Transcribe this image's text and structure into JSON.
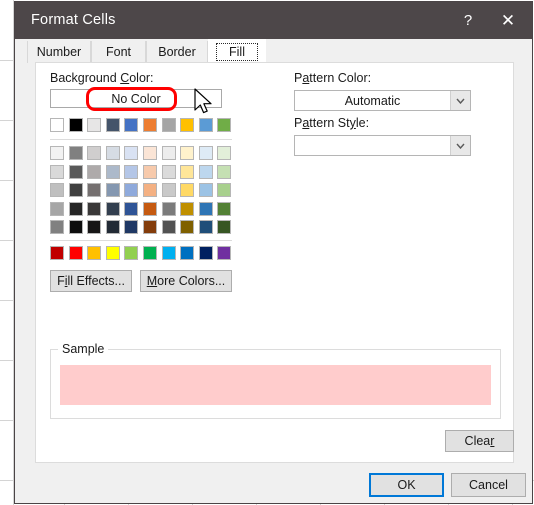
{
  "window": {
    "title": "Format Cells",
    "help_icon": "?",
    "close_icon": "✕"
  },
  "tabs": [
    {
      "label": "Number",
      "active": false
    },
    {
      "label": "Font",
      "active": false
    },
    {
      "label": "Border",
      "active": false
    },
    {
      "label": "Fill",
      "active": true
    }
  ],
  "fill_tab": {
    "background_color_label_pre": "Background ",
    "background_color_label_accel": "C",
    "background_color_label_post": "olor:",
    "no_color_button": "No Color",
    "fill_effects_pre": "F",
    "fill_effects_accel": "i",
    "fill_effects_post": "ll Effects...",
    "more_colors_accel": "M",
    "more_colors_post": "ore Colors...",
    "pattern_color_label_pre": "P",
    "pattern_color_label_accel": "a",
    "pattern_color_label_post": "ttern Color:",
    "pattern_color_value": "Automatic",
    "pattern_style_label_pre": "P",
    "pattern_style_label_accel": "a",
    "pattern_style_label_post": "ttern St",
    "pattern_style_label_accel2": "y",
    "pattern_style_label_post2": "le:",
    "pattern_style_value": "",
    "dropdown_arrow_icon": "⌄",
    "sample_group_label": "Sample",
    "sample_fill_color": "#ffcccc"
  },
  "palette": {
    "theme_row": [
      "#ffffff",
      "#000000",
      "#e7e6e6",
      "#44546a",
      "#4472c4",
      "#ed7d31",
      "#a5a5a5",
      "#ffc000",
      "#5b9bd5",
      "#70ad47"
    ],
    "theme_variants": [
      [
        "#f2f2f2",
        "#808080",
        "#d0cece",
        "#d6dce4",
        "#d9e2f3",
        "#fbe5d6",
        "#ededed",
        "#fff2cc",
        "#deebf6",
        "#e2efd9"
      ],
      [
        "#d9d9d9",
        "#595959",
        "#aeaaaa",
        "#acb9ca",
        "#b4c6e7",
        "#f7caac",
        "#dbdbdb",
        "#ffe699",
        "#bdd7ee",
        "#c5e0b3"
      ],
      [
        "#bfbfbf",
        "#404040",
        "#757070",
        "#8497b0",
        "#8faadc",
        "#f4b183",
        "#c9c9c9",
        "#ffd965",
        "#9cc3e5",
        "#a8d08d"
      ],
      [
        "#a6a6a6",
        "#262626",
        "#3a3838",
        "#333f4f",
        "#2f5496",
        "#c55a11",
        "#7b7b7b",
        "#bf8f00",
        "#2e75b5",
        "#538135"
      ],
      [
        "#808080",
        "#0d0d0d",
        "#171616",
        "#222a35",
        "#1f3864",
        "#833c0b",
        "#525252",
        "#7f6000",
        "#1f4e79",
        "#375623"
      ]
    ],
    "standard_row": [
      "#c00000",
      "#ff0000",
      "#ffc000",
      "#ffff00",
      "#92d050",
      "#00b050",
      "#00b0f0",
      "#0070c0",
      "#002060",
      "#7030a0"
    ]
  },
  "footer": {
    "clear_pre": "Clea",
    "clear_accel": "r",
    "ok_label": "OK",
    "cancel_label": "Cancel"
  },
  "annotation": {
    "shape": "red-oval-highlight",
    "color": "#ff0000",
    "target": "No Color"
  },
  "cursor": {
    "icon": "arrow-pointer"
  }
}
